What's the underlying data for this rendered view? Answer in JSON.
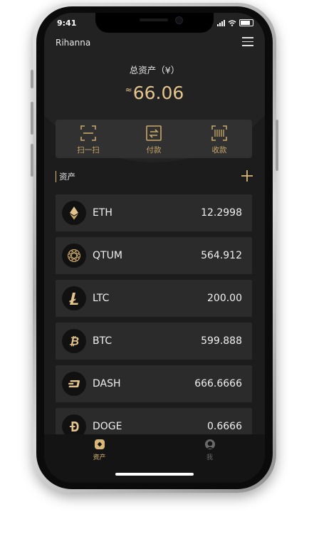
{
  "status_bar": {
    "time": "9:41"
  },
  "header": {
    "username": "Rihanna",
    "menu_icon": "hamburger-menu-icon"
  },
  "summary": {
    "label": "总资产（¥）",
    "approx_symbol": "≈",
    "value": "66.06"
  },
  "actions": [
    {
      "label": "扫一扫",
      "icon": "scan-icon"
    },
    {
      "label": "付款",
      "icon": "transfer-icon"
    },
    {
      "label": "收款",
      "icon": "barcode-icon"
    }
  ],
  "assets_section": {
    "title": "资产",
    "add_icon": "plus-icon"
  },
  "assets": [
    {
      "name": "ETH",
      "amount": "12.2998",
      "icon": "eth-icon"
    },
    {
      "name": "QTUM",
      "amount": "564.912",
      "icon": "qtum-icon"
    },
    {
      "name": "LTC",
      "amount": "200.00",
      "icon": "ltc-icon"
    },
    {
      "name": "BTC",
      "amount": "599.888",
      "icon": "btc-icon"
    },
    {
      "name": "DASH",
      "amount": "666.6666",
      "icon": "dash-icon"
    },
    {
      "name": "DOGE",
      "amount": "0.6666",
      "icon": "doge-icon"
    }
  ],
  "tabbar": [
    {
      "label": "资产",
      "icon": "assets-tab-icon",
      "active": true
    },
    {
      "label": "我",
      "icon": "profile-tab-icon",
      "active": false
    }
  ],
  "colors": {
    "accent": "#d9b877",
    "background": "#1c1c1c",
    "card": "#2b2b2b",
    "inactive": "#6a6a6a"
  }
}
